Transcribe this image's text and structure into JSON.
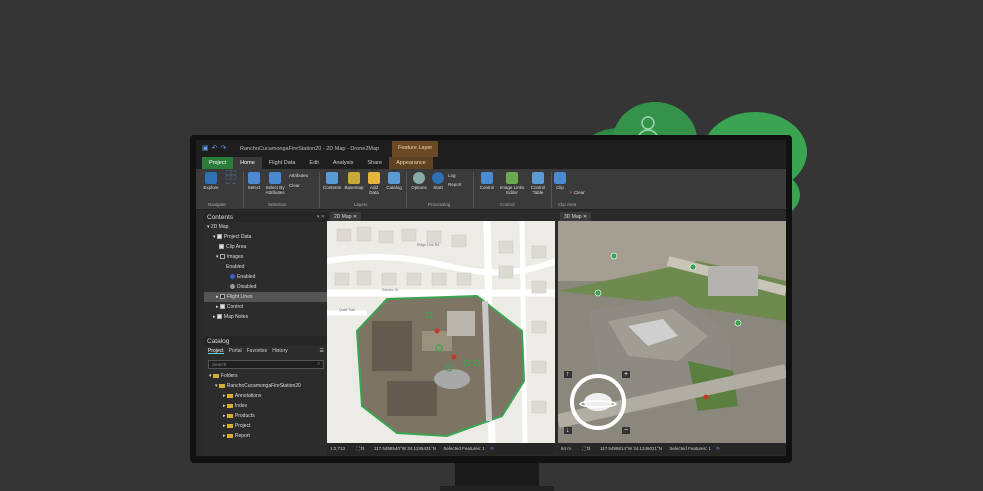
{
  "window": {
    "title": "RanchoCucamongaFireStation20 - 2D Map - Drone2Map",
    "contextual_tab": "Feature Layer"
  },
  "tabs": [
    "Project",
    "Home",
    "Flight Data",
    "Edit",
    "Analysis",
    "Share",
    "Appearance"
  ],
  "ribbon": {
    "buttons": {
      "explore": "Explore",
      "select": "Select",
      "select_by_attributes": "Select By Attributes",
      "attributes": "Attributes",
      "clear": "Clear",
      "contents": "Contents",
      "basemap": "Basemap",
      "add_data": "Add Data",
      "catalog": "Catalog",
      "options": "Options",
      "start": "Start",
      "log": "Log",
      "report": "Report",
      "control": "Control",
      "image_links_editor": "Image Links Editor",
      "control_table": "Control Table",
      "clip": "Clip",
      "clip_clear": "Clear"
    },
    "groups": {
      "navigate": "Navigate",
      "selection": "Selection",
      "layers": "Layers",
      "processing": "Processing",
      "control": "Control",
      "clip_area": "Clip Area"
    }
  },
  "contents": {
    "title": "Contents",
    "items": [
      "2D Map",
      "Project Data",
      "Clip Area",
      "Images",
      "Enabled",
      "Enabled",
      "Disabled",
      "Flight Lines",
      "Control",
      "Map Notes"
    ]
  },
  "catalog": {
    "title": "Catalog",
    "tabs": [
      "Project",
      "Portal",
      "Favorites",
      "History"
    ],
    "search_placeholder": "Search",
    "folders_label": "Folders",
    "project_folder": "RanchoCucamongaFireStation20",
    "subfolders": [
      "Annotations",
      "Index",
      "Products",
      "Project",
      "Report"
    ]
  },
  "views": {
    "map2d_tab": "2D Map",
    "map3d_tab": "3D Map",
    "streets": [
      "Ridge Line Rd",
      "Rancho St",
      "Quail Trail"
    ]
  },
  "status2d": {
    "scale": "1:2,713",
    "coords": "117.5498540°W 34.1245431°N",
    "selected": "Selected Features: 1"
  },
  "status3d": {
    "scale": "64 m",
    "coords": "117.5499814°W 34.1246021°N",
    "selected": "Selected Features: 1"
  },
  "colors": {
    "cloud": "#3aa15a",
    "cloud_light": "#4fb56a",
    "accent_project": "#2d7d3a",
    "contextual": "#6a4a26"
  }
}
